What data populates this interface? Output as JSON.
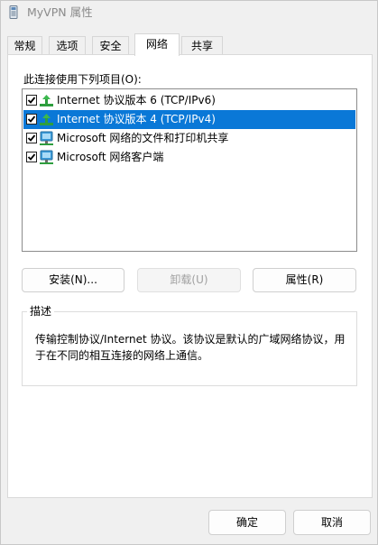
{
  "window": {
    "title": "MyVPN 属性"
  },
  "tabs": [
    {
      "label": "常规"
    },
    {
      "label": "选项"
    },
    {
      "label": "安全"
    },
    {
      "label": "网络"
    },
    {
      "label": "共享"
    }
  ],
  "network_tab": {
    "components_label": "此连接使用下列项目(O):",
    "items": [
      {
        "label": "Internet 协议版本 6 (TCP/IPv6)",
        "checked": true,
        "selected": false,
        "icon": "network-protocol-icon"
      },
      {
        "label": "Internet 协议版本 4 (TCP/IPv4)",
        "checked": true,
        "selected": true,
        "icon": "network-protocol-icon"
      },
      {
        "label": "Microsoft 网络的文件和打印机共享",
        "checked": true,
        "selected": false,
        "icon": "network-service-icon"
      },
      {
        "label": "Microsoft 网络客户端",
        "checked": true,
        "selected": false,
        "icon": "network-client-icon"
      }
    ],
    "install_label": "安装(N)...",
    "uninstall_label": "卸载(U)",
    "properties_label": "属性(R)",
    "description_title": "描述",
    "description_text": "传输控制协议/Internet 协议。该协议是默认的广域网络协议，用于在不同的相互连接的网络上通信。"
  },
  "footer": {
    "ok_label": "确定",
    "cancel_label": "取消"
  },
  "colors": {
    "selection": "#0a78d7",
    "protocol_icon": "#2e9e3e",
    "monitor_icon": "#3a9bd9"
  }
}
